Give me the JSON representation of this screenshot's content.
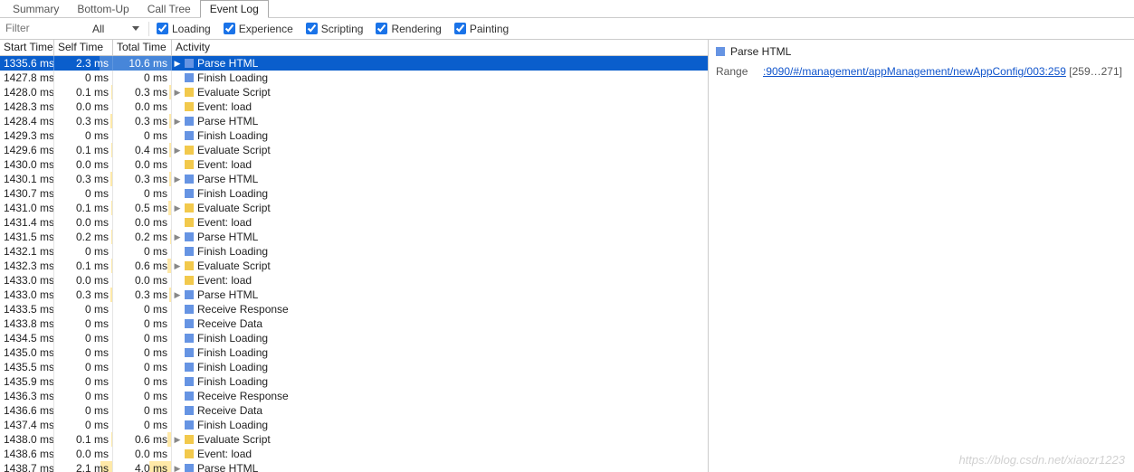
{
  "tabs": [
    "Summary",
    "Bottom-Up",
    "Call Tree",
    "Event Log"
  ],
  "active_tab": 3,
  "toolbar": {
    "filter_placeholder": "Filter",
    "filter_select": "All",
    "checks": [
      {
        "label": "Loading",
        "checked": true
      },
      {
        "label": "Experience",
        "checked": true
      },
      {
        "label": "Scripting",
        "checked": true
      },
      {
        "label": "Rendering",
        "checked": true
      },
      {
        "label": "Painting",
        "checked": true
      }
    ]
  },
  "columns": [
    "Start Time",
    "Self Time",
    "Total Time",
    "Activity"
  ],
  "colors": {
    "loading": "#6694e3",
    "scripting": "#f2c94c",
    "selected": "#0a5ecc"
  },
  "max_total_ms": 10.6,
  "rows": [
    {
      "start": "1335.6 ms",
      "self": "2.3 ms",
      "self_ms": 2.3,
      "total": "10.6 ms",
      "total_ms": 10.6,
      "activity": "Parse HTML",
      "cat": "loading",
      "expandable": true,
      "selected": true
    },
    {
      "start": "1427.8 ms",
      "self": "0 ms",
      "self_ms": 0,
      "total": "0 ms",
      "total_ms": 0,
      "activity": "Finish Loading",
      "cat": "loading",
      "expandable": false
    },
    {
      "start": "1428.0 ms",
      "self": "0.1 ms",
      "self_ms": 0.1,
      "total": "0.3 ms",
      "total_ms": 0.3,
      "activity": "Evaluate Script",
      "cat": "scripting",
      "expandable": true
    },
    {
      "start": "1428.3 ms",
      "self": "0.0 ms",
      "self_ms": 0,
      "total": "0.0 ms",
      "total_ms": 0,
      "activity": "Event: load",
      "cat": "scripting",
      "expandable": false
    },
    {
      "start": "1428.4 ms",
      "self": "0.3 ms",
      "self_ms": 0.3,
      "total": "0.3 ms",
      "total_ms": 0.3,
      "activity": "Parse HTML",
      "cat": "loading",
      "expandable": true
    },
    {
      "start": "1429.3 ms",
      "self": "0 ms",
      "self_ms": 0,
      "total": "0 ms",
      "total_ms": 0,
      "activity": "Finish Loading",
      "cat": "loading",
      "expandable": false
    },
    {
      "start": "1429.6 ms",
      "self": "0.1 ms",
      "self_ms": 0.1,
      "total": "0.4 ms",
      "total_ms": 0.4,
      "activity": "Evaluate Script",
      "cat": "scripting",
      "expandable": true
    },
    {
      "start": "1430.0 ms",
      "self": "0.0 ms",
      "self_ms": 0,
      "total": "0.0 ms",
      "total_ms": 0,
      "activity": "Event: load",
      "cat": "scripting",
      "expandable": false
    },
    {
      "start": "1430.1 ms",
      "self": "0.3 ms",
      "self_ms": 0.3,
      "total": "0.3 ms",
      "total_ms": 0.3,
      "activity": "Parse HTML",
      "cat": "loading",
      "expandable": true
    },
    {
      "start": "1430.7 ms",
      "self": "0 ms",
      "self_ms": 0,
      "total": "0 ms",
      "total_ms": 0,
      "activity": "Finish Loading",
      "cat": "loading",
      "expandable": false
    },
    {
      "start": "1431.0 ms",
      "self": "0.1 ms",
      "self_ms": 0.1,
      "total": "0.5 ms",
      "total_ms": 0.5,
      "activity": "Evaluate Script",
      "cat": "scripting",
      "expandable": true
    },
    {
      "start": "1431.4 ms",
      "self": "0.0 ms",
      "self_ms": 0,
      "total": "0.0 ms",
      "total_ms": 0,
      "activity": "Event: load",
      "cat": "scripting",
      "expandable": false
    },
    {
      "start": "1431.5 ms",
      "self": "0.2 ms",
      "self_ms": 0.2,
      "total": "0.2 ms",
      "total_ms": 0.2,
      "activity": "Parse HTML",
      "cat": "loading",
      "expandable": true
    },
    {
      "start": "1432.1 ms",
      "self": "0 ms",
      "self_ms": 0,
      "total": "0 ms",
      "total_ms": 0,
      "activity": "Finish Loading",
      "cat": "loading",
      "expandable": false
    },
    {
      "start": "1432.3 ms",
      "self": "0.1 ms",
      "self_ms": 0.1,
      "total": "0.6 ms",
      "total_ms": 0.6,
      "activity": "Evaluate Script",
      "cat": "scripting",
      "expandable": true
    },
    {
      "start": "1433.0 ms",
      "self": "0.0 ms",
      "self_ms": 0,
      "total": "0.0 ms",
      "total_ms": 0,
      "activity": "Event: load",
      "cat": "scripting",
      "expandable": false
    },
    {
      "start": "1433.0 ms",
      "self": "0.3 ms",
      "self_ms": 0.3,
      "total": "0.3 ms",
      "total_ms": 0.3,
      "activity": "Parse HTML",
      "cat": "loading",
      "expandable": true
    },
    {
      "start": "1433.5 ms",
      "self": "0 ms",
      "self_ms": 0,
      "total": "0 ms",
      "total_ms": 0,
      "activity": "Receive Response",
      "cat": "loading",
      "expandable": false
    },
    {
      "start": "1433.8 ms",
      "self": "0 ms",
      "self_ms": 0,
      "total": "0 ms",
      "total_ms": 0,
      "activity": "Receive Data",
      "cat": "loading",
      "expandable": false
    },
    {
      "start": "1434.5 ms",
      "self": "0 ms",
      "self_ms": 0,
      "total": "0 ms",
      "total_ms": 0,
      "activity": "Finish Loading",
      "cat": "loading",
      "expandable": false
    },
    {
      "start": "1435.0 ms",
      "self": "0 ms",
      "self_ms": 0,
      "total": "0 ms",
      "total_ms": 0,
      "activity": "Finish Loading",
      "cat": "loading",
      "expandable": false
    },
    {
      "start": "1435.5 ms",
      "self": "0 ms",
      "self_ms": 0,
      "total": "0 ms",
      "total_ms": 0,
      "activity": "Finish Loading",
      "cat": "loading",
      "expandable": false
    },
    {
      "start": "1435.9 ms",
      "self": "0 ms",
      "self_ms": 0,
      "total": "0 ms",
      "total_ms": 0,
      "activity": "Finish Loading",
      "cat": "loading",
      "expandable": false
    },
    {
      "start": "1436.3 ms",
      "self": "0 ms",
      "self_ms": 0,
      "total": "0 ms",
      "total_ms": 0,
      "activity": "Receive Response",
      "cat": "loading",
      "expandable": false
    },
    {
      "start": "1436.6 ms",
      "self": "0 ms",
      "self_ms": 0,
      "total": "0 ms",
      "total_ms": 0,
      "activity": "Receive Data",
      "cat": "loading",
      "expandable": false
    },
    {
      "start": "1437.4 ms",
      "self": "0 ms",
      "self_ms": 0,
      "total": "0 ms",
      "total_ms": 0,
      "activity": "Finish Loading",
      "cat": "loading",
      "expandable": false
    },
    {
      "start": "1438.0 ms",
      "self": "0.1 ms",
      "self_ms": 0.1,
      "total": "0.6 ms",
      "total_ms": 0.6,
      "activity": "Evaluate Script",
      "cat": "scripting",
      "expandable": true
    },
    {
      "start": "1438.6 ms",
      "self": "0.0 ms",
      "self_ms": 0,
      "total": "0.0 ms",
      "total_ms": 0,
      "activity": "Event: load",
      "cat": "scripting",
      "expandable": false
    },
    {
      "start": "1438.7 ms",
      "self": "2.1 ms",
      "self_ms": 2.1,
      "total": "4.0 ms",
      "total_ms": 4.0,
      "activity": "Parse HTML",
      "cat": "loading",
      "expandable": true
    }
  ],
  "detail": {
    "icon_cat": "loading",
    "title": "Parse HTML",
    "range_label": "Range",
    "range_link": ":9090/#/management/appManagement/newAppConfig/003:259",
    "range_tail": "[259…271]"
  },
  "watermark": "https://blog.csdn.net/xiaozr1223"
}
